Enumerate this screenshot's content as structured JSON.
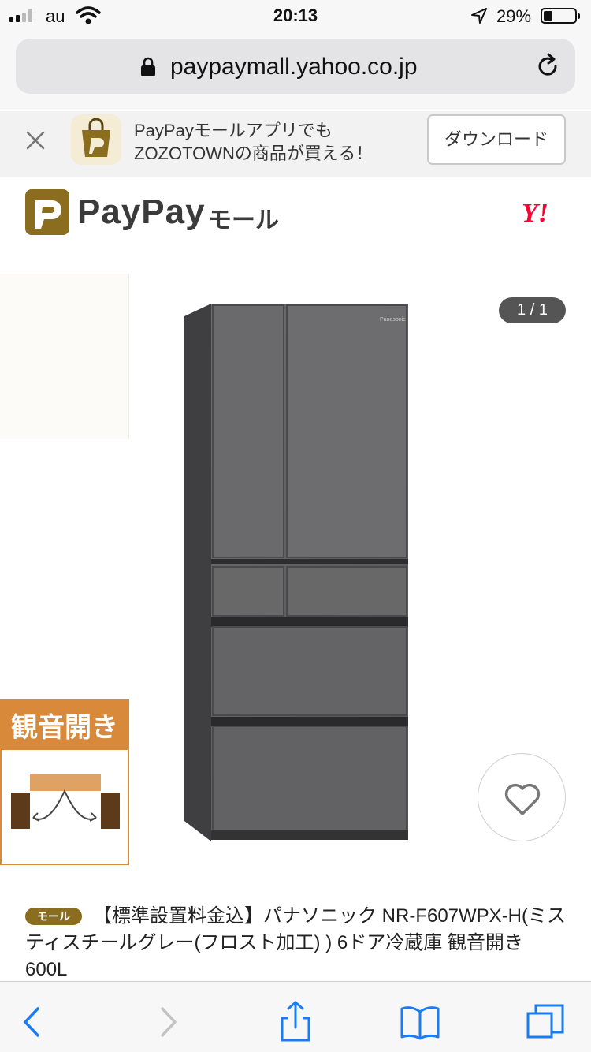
{
  "status_bar": {
    "carrier": "au",
    "time": "20:13",
    "battery": "29%",
    "battery_level": 0.29
  },
  "browser": {
    "url": "paypaymall.yahoo.co.jp"
  },
  "app_banner": {
    "line1": "PayPayモールアプリでも",
    "line2": "ZOZOTOWNの商品が買える！",
    "button": "ダウンロード"
  },
  "header": {
    "logo": "PayPay",
    "logo_sub": "モール",
    "yahoo": "Y!"
  },
  "gallery": {
    "counter": "1 / 1",
    "feature_label": "観音開き",
    "fridge_brand": "Panasonic"
  },
  "product": {
    "badge": "モール",
    "title": "【標準設置料金込】パナソニック NR-F607WPX-H(ミスティスチールグレー(フロスト加工) ) 6ドア冷蔵庫 観音開き 600L"
  },
  "colors": {
    "brand_gold": "#8a6d1e",
    "ios_blue": "#1a7cf5",
    "yahoo_red": "#ff0033"
  }
}
